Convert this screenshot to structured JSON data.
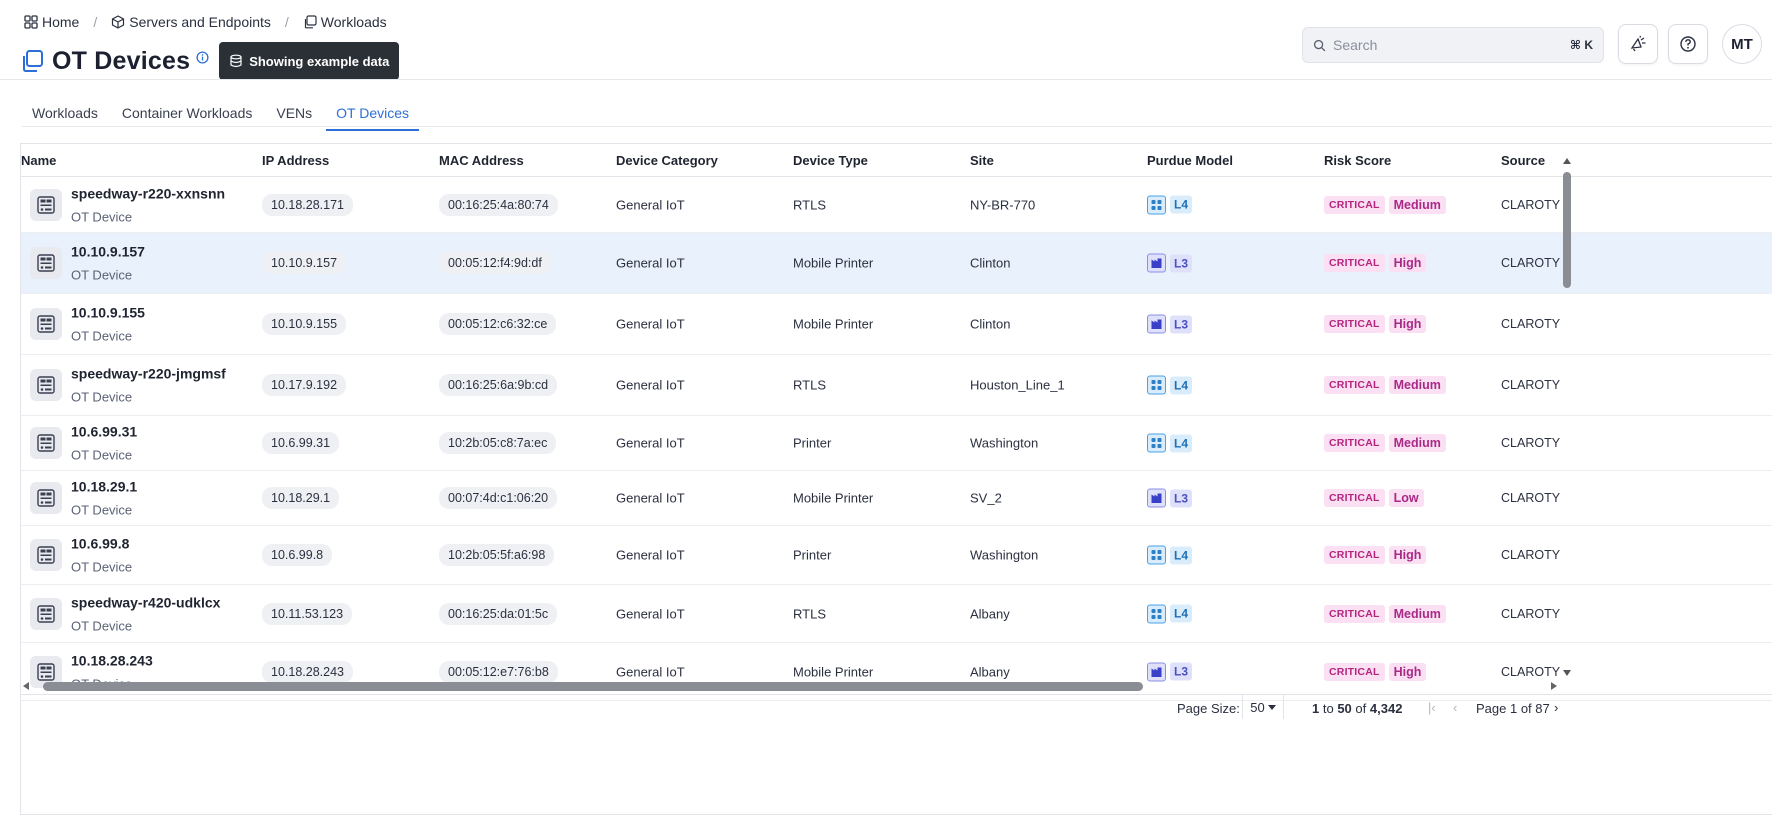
{
  "breadcrumb": [
    {
      "label": "Home",
      "icon": "grid-icon"
    },
    {
      "label": "Servers and Endpoints",
      "icon": "cube-icon"
    },
    {
      "label": "Workloads",
      "icon": "copy-icon"
    }
  ],
  "page": {
    "title": "OT Devices",
    "example_badge": "Showing example data"
  },
  "search": {
    "placeholder": "Search",
    "shortcut": "⌘ K"
  },
  "avatar": {
    "initials": "MT"
  },
  "tabs": [
    {
      "label": "Workloads",
      "active": false
    },
    {
      "label": "Container Workloads",
      "active": false
    },
    {
      "label": "VENs",
      "active": false
    },
    {
      "label": "OT Devices",
      "active": true
    }
  ],
  "table": {
    "columns": [
      "Name",
      "IP Address",
      "MAC Address",
      "Device Category",
      "Device Type",
      "Site",
      "Purdue Model",
      "Risk Score",
      "Source"
    ],
    "rows": [
      {
        "name": "speedway-r220-xxnsnn",
        "sub": "OT Device",
        "ip": "10.18.28.171",
        "mac": "00:16:25:4a:80:74",
        "category": "General IoT",
        "type": "RTLS",
        "site": "NY-BR-770",
        "purdue": "L4",
        "risk_badge": "CRITICAL",
        "risk_level": "Medium",
        "source": "CLAROTY",
        "selected": false
      },
      {
        "name": "10.10.9.157",
        "sub": "OT Device",
        "ip": "10.10.9.157",
        "mac": "00:05:12:f4:9d:df",
        "category": "General IoT",
        "type": "Mobile Printer",
        "site": "Clinton",
        "purdue": "L3",
        "risk_badge": "CRITICAL",
        "risk_level": "High",
        "source": "CLAROTY",
        "selected": true
      },
      {
        "name": "10.10.9.155",
        "sub": "OT Device",
        "ip": "10.10.9.155",
        "mac": "00:05:12:c6:32:ce",
        "category": "General IoT",
        "type": "Mobile Printer",
        "site": "Clinton",
        "purdue": "L3",
        "risk_badge": "CRITICAL",
        "risk_level": "High",
        "source": "CLAROTY",
        "selected": false
      },
      {
        "name": "speedway-r220-jmgmsf",
        "sub": "OT Device",
        "ip": "10.17.9.192",
        "mac": "00:16:25:6a:9b:cd",
        "category": "General IoT",
        "type": "RTLS",
        "site": "Houston_Line_1",
        "purdue": "L4",
        "risk_badge": "CRITICAL",
        "risk_level": "Medium",
        "source": "CLAROTY",
        "selected": false
      },
      {
        "name": "10.6.99.31",
        "sub": "OT Device",
        "ip": "10.6.99.31",
        "mac": "10:2b:05:c8:7a:ec",
        "category": "General IoT",
        "type": "Printer",
        "site": "Washington",
        "purdue": "L4",
        "risk_badge": "CRITICAL",
        "risk_level": "Medium",
        "source": "CLAROTY",
        "selected": false
      },
      {
        "name": "10.18.29.1",
        "sub": "OT Device",
        "ip": "10.18.29.1",
        "mac": "00:07:4d:c1:06:20",
        "category": "General IoT",
        "type": "Mobile Printer",
        "site": "SV_2",
        "purdue": "L3",
        "risk_badge": "CRITICAL",
        "risk_level": "Low",
        "source": "CLAROTY",
        "selected": false
      },
      {
        "name": "10.6.99.8",
        "sub": "OT Device",
        "ip": "10.6.99.8",
        "mac": "10:2b:05:5f:a6:98",
        "category": "General IoT",
        "type": "Printer",
        "site": "Washington",
        "purdue": "L4",
        "risk_badge": "CRITICAL",
        "risk_level": "High",
        "source": "CLAROTY",
        "selected": false
      },
      {
        "name": "speedway-r420-udklcx",
        "sub": "OT Device",
        "ip": "10.11.53.123",
        "mac": "00:16:25:da:01:5c",
        "category": "General IoT",
        "type": "RTLS",
        "site": "Albany",
        "purdue": "L4",
        "risk_badge": "CRITICAL",
        "risk_level": "Medium",
        "source": "CLAROTY",
        "selected": false
      },
      {
        "name": "10.18.28.243",
        "sub": "OT Device",
        "ip": "10.18.28.243",
        "mac": "00:05:12:e7:76:b8",
        "category": "General IoT",
        "type": "Mobile Printer",
        "site": "Albany",
        "purdue": "L3",
        "risk_badge": "CRITICAL",
        "risk_level": "High",
        "source": "CLAROTY",
        "selected": false
      }
    ]
  },
  "footer": {
    "page_size_label": "Page Size:",
    "page_size_value": "50",
    "range_from": "1",
    "range_to_word": "to",
    "range_to": "50",
    "range_of_word": "of",
    "total": "4,342",
    "page_info": "Page 1 of 87"
  },
  "colors": {
    "accent": "#2c6fd6",
    "selected_row": "#e9f1fc",
    "critical_bg": "#fbe0f4",
    "critical_text": "#b4257e",
    "badge_dark": "#2b2f36"
  }
}
